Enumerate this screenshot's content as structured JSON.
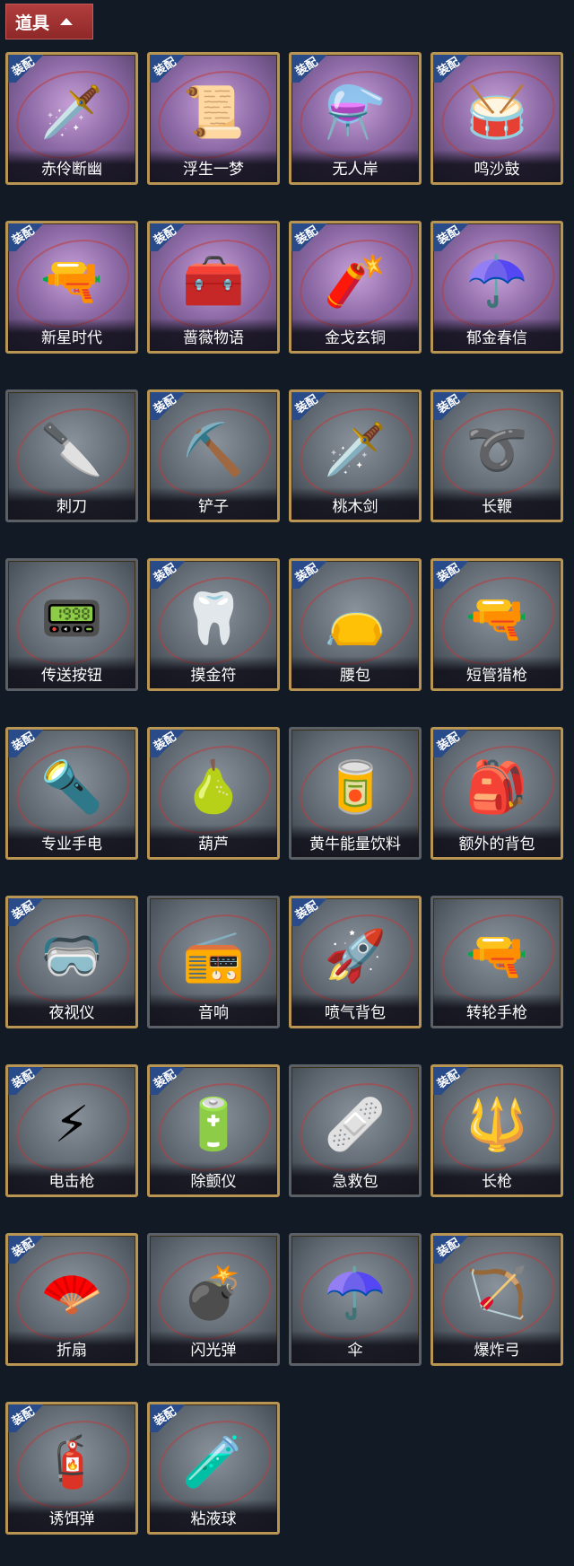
{
  "header": {
    "title": "道具"
  },
  "equip_tag": "装配",
  "items": [
    {
      "name": "赤伶断幽",
      "icon": "🗡️",
      "style": "gold-purple",
      "equipped": true
    },
    {
      "name": "浮生一梦",
      "icon": "📜",
      "style": "gold-purple",
      "equipped": true
    },
    {
      "name": "无人岸",
      "icon": "⚗️",
      "style": "gold-purple",
      "equipped": true
    },
    {
      "name": "鸣沙鼓",
      "icon": "🥁",
      "style": "gold-purple",
      "equipped": true
    },
    {
      "name": "新星时代",
      "icon": "🔫",
      "style": "gold-purple",
      "equipped": true
    },
    {
      "name": "蔷薇物语",
      "icon": "🧰",
      "style": "gold-purple",
      "equipped": true
    },
    {
      "name": "金戈玄铜",
      "icon": "🧨",
      "style": "gold-purple",
      "equipped": true
    },
    {
      "name": "郁金春信",
      "icon": "☂️",
      "style": "gold-purple",
      "equipped": true
    },
    {
      "name": "刺刀",
      "icon": "🔪",
      "style": "gray-noframe",
      "equipped": false
    },
    {
      "name": "铲子",
      "icon": "⛏️",
      "style": "gray",
      "equipped": true
    },
    {
      "name": "桃木剑",
      "icon": "🗡️",
      "style": "gray",
      "equipped": true
    },
    {
      "name": "长鞭",
      "icon": "➰",
      "style": "gray",
      "equipped": true
    },
    {
      "name": "传送按钮",
      "icon": "📟",
      "style": "gray-noframe",
      "equipped": false
    },
    {
      "name": "摸金符",
      "icon": "🦷",
      "style": "gray",
      "equipped": true
    },
    {
      "name": "腰包",
      "icon": "👝",
      "style": "gray",
      "equipped": true
    },
    {
      "name": "短管猎枪",
      "icon": "🔫",
      "style": "gray",
      "equipped": true
    },
    {
      "name": "专业手电",
      "icon": "🔦",
      "style": "gray",
      "equipped": true
    },
    {
      "name": "葫芦",
      "icon": "🍐",
      "style": "gray",
      "equipped": true
    },
    {
      "name": "黄牛能量饮料",
      "icon": "🥫",
      "style": "gray-noframe",
      "equipped": false
    },
    {
      "name": "额外的背包",
      "icon": "🎒",
      "style": "gray",
      "equipped": true
    },
    {
      "name": "夜视仪",
      "icon": "🥽",
      "style": "gray",
      "equipped": true
    },
    {
      "name": "音响",
      "icon": "📻",
      "style": "gray-noframe",
      "equipped": false
    },
    {
      "name": "喷气背包",
      "icon": "🚀",
      "style": "gray",
      "equipped": true
    },
    {
      "name": "转轮手枪",
      "icon": "🔫",
      "style": "gray-noframe",
      "equipped": false
    },
    {
      "name": "电击枪",
      "icon": "⚡",
      "style": "gray",
      "equipped": true
    },
    {
      "name": "除颤仪",
      "icon": "🔋",
      "style": "gray",
      "equipped": true
    },
    {
      "name": "急救包",
      "icon": "🩹",
      "style": "gray-noframe",
      "equipped": false
    },
    {
      "name": "长枪",
      "icon": "🔱",
      "style": "gray",
      "equipped": true
    },
    {
      "name": "折扇",
      "icon": "🪭",
      "style": "gray",
      "equipped": true
    },
    {
      "name": "闪光弹",
      "icon": "💣",
      "style": "gray-noframe",
      "equipped": false
    },
    {
      "name": "伞",
      "icon": "☂️",
      "style": "gray-noframe",
      "equipped": false
    },
    {
      "name": "爆炸弓",
      "icon": "🏹",
      "style": "gray",
      "equipped": true
    },
    {
      "name": "诱饵弹",
      "icon": "🧯",
      "style": "gray",
      "equipped": true
    },
    {
      "name": "粘液球",
      "icon": "🧪",
      "style": "gray",
      "equipped": true
    }
  ]
}
